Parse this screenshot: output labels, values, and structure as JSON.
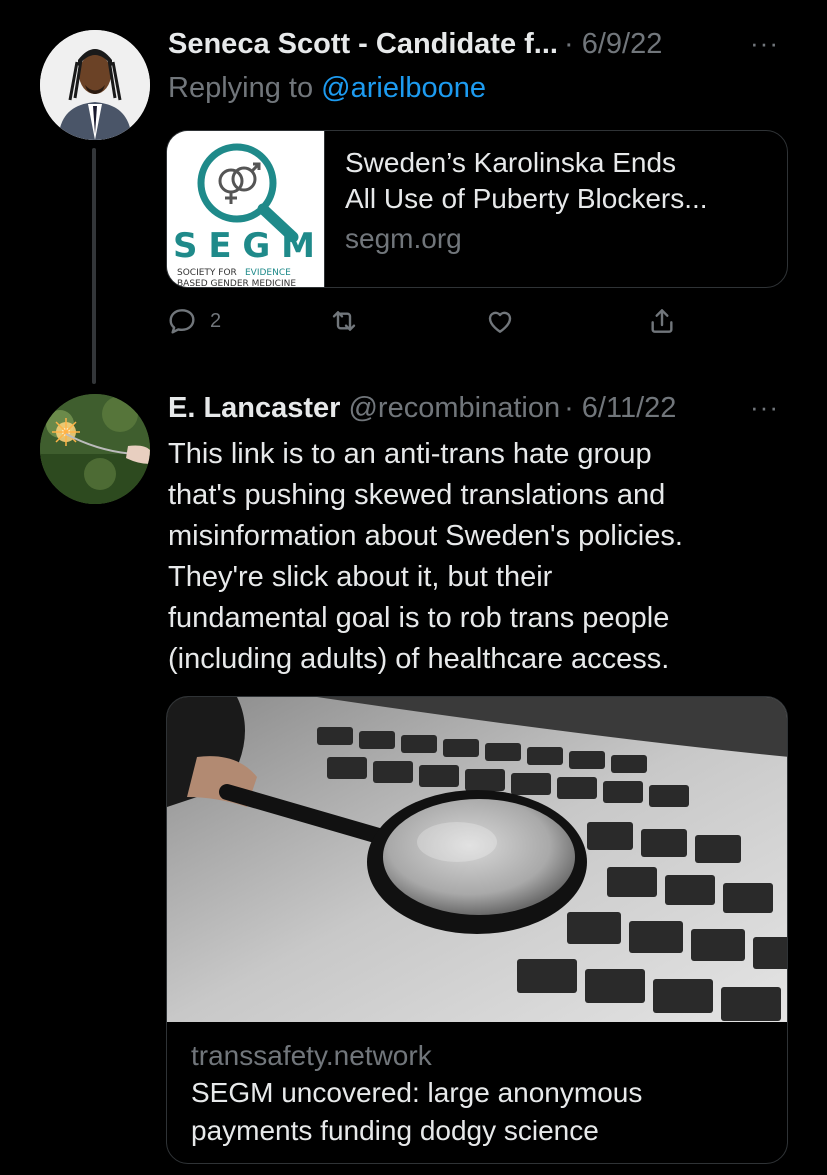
{
  "tweet1": {
    "display_name": "Seneca Scott - Candidate f...",
    "date": "· 6/9/22",
    "more": "···",
    "replying_prefix": "Replying to",
    "replying_to": "@arielboone",
    "card": {
      "title_line1": "Sweden’s Karolinska Ends",
      "title_line2": "All Use of Puberty Blockers...",
      "domain": "segm.org",
      "logo_text": "SEGM",
      "logo_sub1": "SOCIETY FOR",
      "logo_sub1_accent": "EVIDENCE",
      "logo_sub2": "BASED GENDER MEDICINE"
    },
    "reply_count": "2",
    "icons": [
      "reply-icon",
      "retweet-icon",
      "like-icon",
      "share-icon"
    ]
  },
  "tweet2": {
    "display_name": "E. Lancaster",
    "handle": "@recombination",
    "date": "· 6/11/22",
    "more": "···",
    "body_lines": [
      "This link is to an anti-trans hate group",
      "that's pushing skewed translations and",
      "misinformation about Sweden's policies.",
      "They're slick about it, but their",
      "fundamental goal is to rob trans people",
      "(including adults) of healthcare access."
    ],
    "card": {
      "domain": "transsafety.network",
      "title_line1": "SEGM uncovered: large anonymous",
      "title_line2": "payments funding dodgy science"
    }
  },
  "colors": {
    "background": "#000000",
    "text_primary": "#e7e9ea",
    "text_secondary": "#71767b",
    "link": "#1d9bf0",
    "border": "#2f3336",
    "segm_teal": "#1f8a8a"
  }
}
